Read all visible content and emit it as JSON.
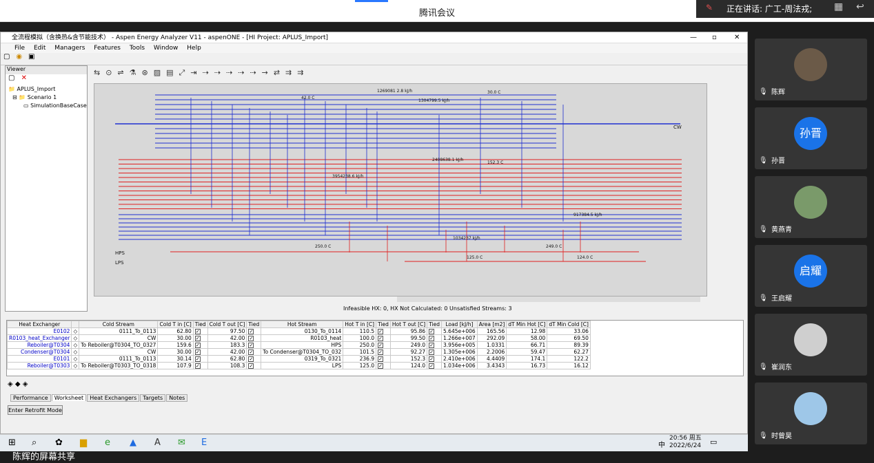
{
  "meeting": {
    "title": "腾讯会议",
    "speaking": "正在讲话: 广工-周法戎;",
    "screen_share": "陈辉的屏幕共享"
  },
  "app": {
    "title": "全流程模拟（含换热&含节能技术） - Aspen Energy Analyzer V11 - aspenONE - [HI Project:  APLUS_Import]",
    "menu": [
      "File",
      "Edit",
      "Managers",
      "Features",
      "Tools",
      "Window",
      "Help"
    ],
    "viewer": {
      "header": "Viewer",
      "tree": [
        "APLUS_Import",
        "Scenario 1",
        "SimulationBaseCase"
      ]
    },
    "status": "Infeasible HX: 0, HX Not Calculated: 0  Unsatisfied Streams: 3",
    "tabs": [
      "Performance",
      "Worksheet",
      "Heat Exchangers",
      "Targets",
      "Notes"
    ],
    "active_tab": "Worksheet",
    "retrofit_button": "Enter Retrofit Mode"
  },
  "grid": {
    "columns": [
      "Heat Exchanger",
      "",
      "Cold Stream",
      "Cold T in\n[C]",
      "Tied",
      "Cold T out\n[C]",
      "Tied",
      "Hot Stream",
      "Hot T in\n[C]",
      "Tied",
      "Hot T out\n[C]",
      "Tied",
      "Load\n[kJ/h]",
      "Area\n[m2]",
      "dT Min Hot\n[C]",
      "dT Min Cold\n[C]"
    ],
    "rows": [
      {
        "hx": "E0102",
        "cold": "0111_To_0113",
        "ctin": "62.80",
        "ctout": "97.50",
        "hot": "0130_To_0114",
        "htin": "110.5",
        "htout": "95.86",
        "load": "5.645e+006",
        "area": "165.56",
        "dthot": "12.98",
        "dtcold": "33.06"
      },
      {
        "hx": "R0103_heat_Exchanger",
        "cold": "CW",
        "ctin": "30.00",
        "ctout": "42.00",
        "hot": "R0103_heat",
        "htin": "100.0",
        "htout": "99.50",
        "load": "1.266e+007",
        "area": "292.09",
        "dthot": "58.00",
        "dtcold": "69.50"
      },
      {
        "hx": "Reboiler@T0304",
        "cold": "To Reboiler@T0304_TO_0327",
        "ctin": "159.6",
        "ctout": "183.3",
        "hot": "HPS",
        "htin": "250.0",
        "htout": "249.0",
        "load": "3.956e+005",
        "area": "1.0331",
        "dthot": "66.71",
        "dtcold": "89.39"
      },
      {
        "hx": "Condenser@T0304",
        "cold": "CW",
        "ctin": "30.00",
        "ctout": "42.00",
        "hot": "To Condenser@T0304_TO_032",
        "htin": "101.5",
        "htout": "92.27",
        "load": "1.305e+006",
        "area": "2.2006",
        "dthot": "59.47",
        "dtcold": "62.27"
      },
      {
        "hx": "E0101",
        "cold": "0111_To_0113",
        "ctin": "30.14",
        "ctout": "62.80",
        "hot": "0319_To_0321",
        "htin": "236.9",
        "htout": "152.3",
        "load": "2.410e+006",
        "area": "4.4409",
        "dthot": "174.1",
        "dtcold": "122.2"
      },
      {
        "hx": "Reboiler@T0303",
        "cold": "To Reboiler@T0303_TO_0318",
        "ctin": "107.9",
        "ctout": "108.3",
        "hot": "LPS",
        "htin": "125.0",
        "htout": "124.0",
        "load": "1.034e+006",
        "area": "3.4343",
        "dthot": "16.73",
        "dtcold": "16.12"
      }
    ]
  },
  "diagram": {
    "cold_labels_left": [
      "CW"
    ],
    "cold_label_right": "CW",
    "hot_labels": [
      "HPS",
      "LPS"
    ],
    "temps": [
      "42.0 C",
      "30.0 C",
      "250.0 C",
      "249.0 C",
      "124.0 C",
      "125.0 C",
      "152.3 C"
    ],
    "loads": [
      "1269081 2.8 kJ/h",
      "1304799.5 kJ/h",
      "2408638.1 kJ/h",
      "3954238.6 kJ/h",
      "1034237 kJ/h",
      "917384.5 kJ/h"
    ]
  },
  "participants": [
    {
      "name": "陈辉",
      "initial": "",
      "color": "#6b5a48"
    },
    {
      "name": "孙晋",
      "initial": "孙晋",
      "color": "#1a73e8"
    },
    {
      "name": "黄燕青",
      "initial": "",
      "color": "#7a9a6a"
    },
    {
      "name": "王启耀",
      "initial": "启耀",
      "color": "#1a73e8"
    },
    {
      "name": "崔润东",
      "initial": "",
      "color": "#cfcfcf"
    },
    {
      "name": "时曾昊",
      "initial": "",
      "color": "#9ec7e8"
    }
  ],
  "taskbar": {
    "time": "20:56 周五",
    "date": "2022/6/24",
    "ime": "中"
  }
}
